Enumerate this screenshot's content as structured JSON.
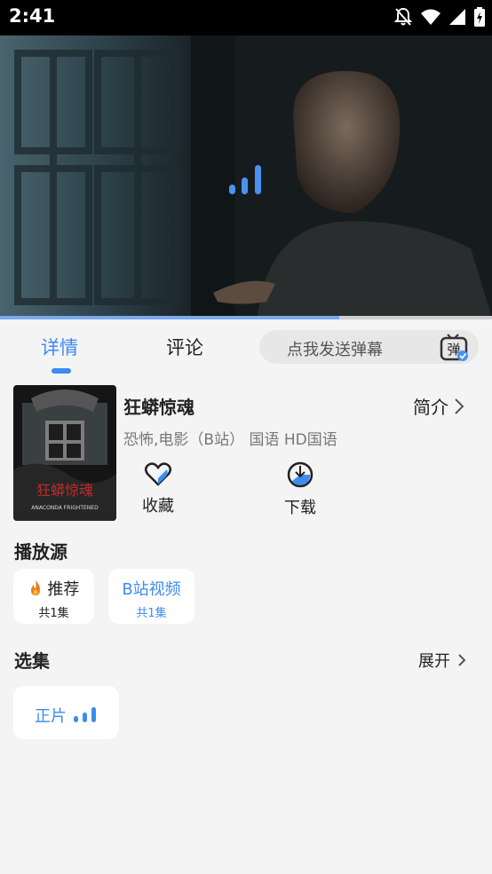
{
  "status_bar": {
    "time": "2:41"
  },
  "player": {
    "progress_fraction": 0.69
  },
  "tabs": [
    {
      "label": "详情"
    },
    {
      "label": "评论"
    }
  ],
  "danmaku": {
    "placeholder": "点我发送弹幕",
    "icon_text": "弹"
  },
  "movie": {
    "title": "狂蟒惊魂",
    "meta": "恐怖,电影（B站） 国语 HD国语",
    "intro_label": "简介",
    "poster_title": "狂蟒惊魂",
    "poster_subtitle": "ANACONDA FRIGHTENED"
  },
  "actions": {
    "favorite_label": "收藏",
    "download_label": "下载"
  },
  "sources": {
    "title": "播放源",
    "items": [
      {
        "icon": "fire-icon",
        "label": "推荐",
        "count": "共1集"
      },
      {
        "label": "B站视频",
        "count": "共1集"
      }
    ]
  },
  "episodes": {
    "title": "选集",
    "expand_label": "展开",
    "items": [
      {
        "label": "正片"
      }
    ]
  },
  "colors": {
    "accent": "#3d8cf0",
    "background": "#f4f4f4"
  }
}
